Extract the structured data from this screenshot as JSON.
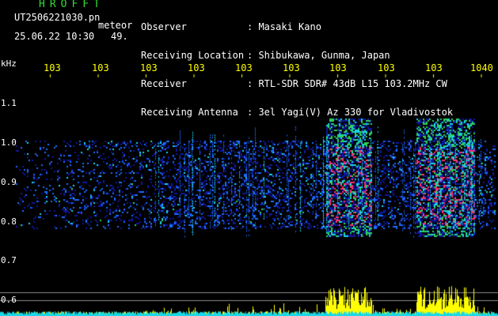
{
  "header": {
    "brand": "HROFFT",
    "file_name": "UT2506221030.pn",
    "mode": "meteor",
    "datetime": "25.06.22 10:30",
    "count": "49.",
    "info_labels": [
      "Observer",
      "Receiving Location",
      "Receiver",
      "Receiving Antenna"
    ],
    "info_values": [
      ": Masaki Kano",
      ": Shibukawa, Gunma, Japan",
      ": RTL-SDR SDR# 43dB L15 103.2MHz CW",
      ": 3el Yagi(V) Az 330 for Vladivostok"
    ]
  },
  "spectrogram": {
    "y_unit": "kHz",
    "x_ticks": [
      "103",
      "103",
      "103",
      "103",
      "103",
      "103",
      "103",
      "103",
      "103",
      "1040"
    ],
    "y_ticks": [
      "1.1",
      "1.0",
      "0.9",
      "0.8",
      "0.7",
      "0.6"
    ],
    "colors": {
      "background": "#000000",
      "noise_low": "#1018a0",
      "noise_mid": "#1c6cff",
      "signal_cyan": "#19d7e6",
      "signal_green": "#2ed25a",
      "signal_red": "#ff2f6e",
      "meter_yellow": "#ffff00",
      "meter_cyan": "#19d7e6",
      "grid": "#8c8c8c",
      "axis_yellow": "#ffff00"
    }
  }
}
